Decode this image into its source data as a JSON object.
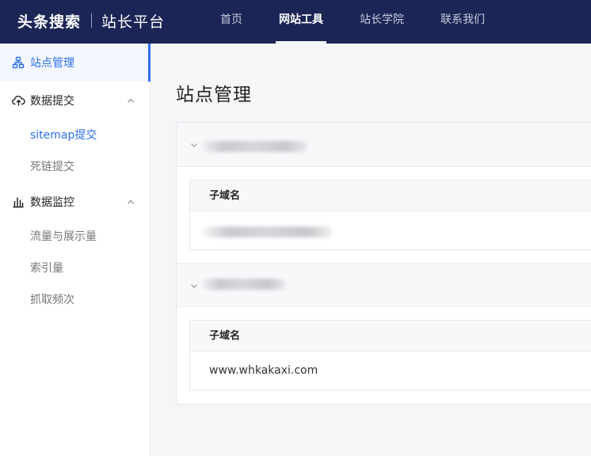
{
  "header": {
    "brand": "头条搜索",
    "platform": "站长平台",
    "nav": [
      {
        "label": "首页",
        "active": false
      },
      {
        "label": "网站工具",
        "active": true
      },
      {
        "label": "站长学院",
        "active": false
      },
      {
        "label": "联系我们",
        "active": false
      }
    ]
  },
  "sidebar": {
    "site_manage": "站点管理",
    "data_submit": {
      "label": "数据提交",
      "children": [
        "sitemap提交",
        "死链提交"
      ]
    },
    "data_monitor": {
      "label": "数据监控",
      "children": [
        "流量与展示量",
        "索引量",
        "抓取频次"
      ]
    }
  },
  "main": {
    "title": "站点管理",
    "groups": [
      {
        "column_header": "子域名",
        "domain": ""
      },
      {
        "column_header": "子域名",
        "domain": "www.whkakaxi.com"
      }
    ]
  },
  "colors": {
    "topbar": "#1b2556",
    "accent": "#2a6ff0",
    "muted": "#777777"
  },
  "icons": {
    "site_manage": "sitemap-icon",
    "data_submit": "cloud-upload-icon",
    "data_monitor": "bar-chart-icon"
  }
}
